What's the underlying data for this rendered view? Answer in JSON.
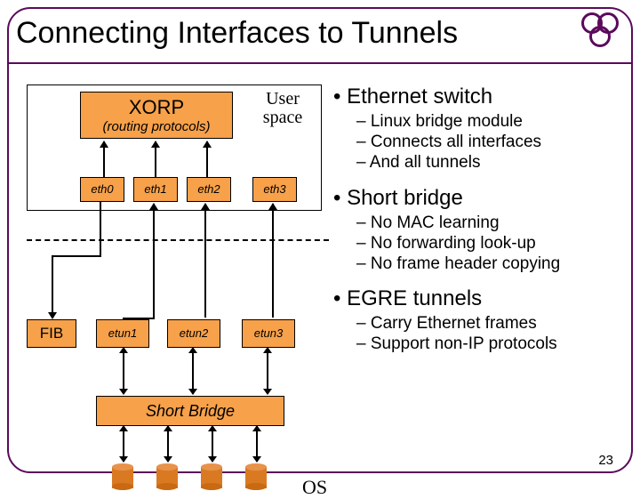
{
  "title": "Connecting Interfaces to Tunnels",
  "page_number": "23",
  "diagram": {
    "xorp_title": "XORP",
    "xorp_sub": "(routing protocols)",
    "userspace_l1": "User",
    "userspace_l2": "space",
    "eth": [
      "eth0",
      "eth1",
      "eth2",
      "eth3"
    ],
    "fib": "FIB",
    "etun": [
      "etun1",
      "etun2",
      "etun3"
    ],
    "short_bridge": "Short Bridge",
    "os": "OS"
  },
  "bullets": [
    {
      "level": 1,
      "text": "Ethernet switch"
    },
    {
      "level": 2,
      "text": "Linux bridge module"
    },
    {
      "level": 2,
      "text": "Connects all interfaces"
    },
    {
      "level": 2,
      "text": "And all tunnels"
    },
    {
      "level": 0,
      "text": ""
    },
    {
      "level": 1,
      "text": "Short bridge"
    },
    {
      "level": 2,
      "text": "No MAC learning"
    },
    {
      "level": 2,
      "text": "No forwarding look-up"
    },
    {
      "level": 2,
      "text": "No frame header copying"
    },
    {
      "level": 0,
      "text": ""
    },
    {
      "level": 1,
      "text": "EGRE tunnels"
    },
    {
      "level": 2,
      "text": "Carry Ethernet frames"
    },
    {
      "level": 2,
      "text": "Support non-IP protocols"
    }
  ]
}
